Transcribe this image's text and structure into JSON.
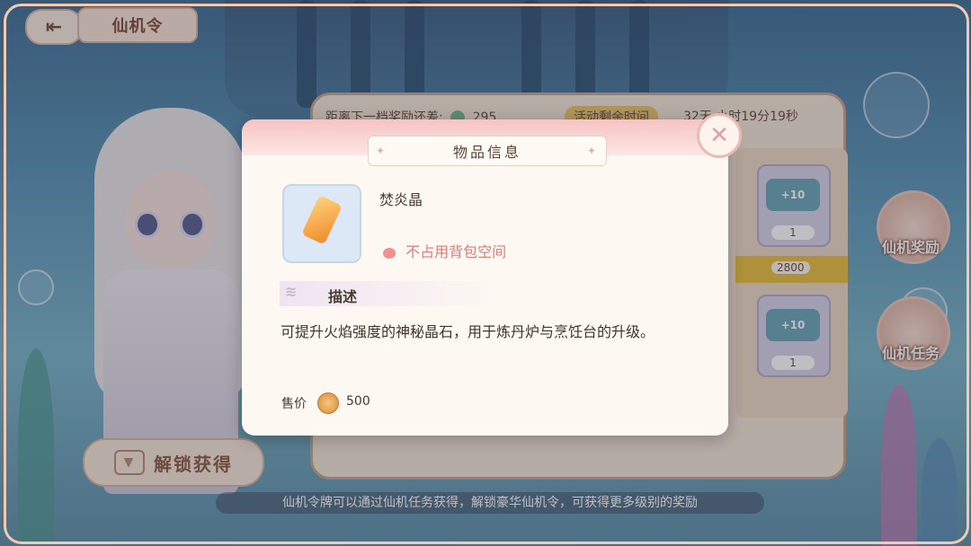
{
  "header": {
    "back_icon": "back-arrow-icon",
    "title": "仙机令"
  },
  "background": {
    "next_reward_label": "距离下一档奖励还差:",
    "next_reward_value": "295",
    "time_tag": "活动剩余时间",
    "time_value": "32天 小时19分19秒",
    "level_points": "2800",
    "reward_cards": [
      {
        "badge": "+10",
        "count": "1"
      },
      {
        "badge": "+10",
        "count": "1"
      }
    ],
    "unlock_button": "解锁获得",
    "side_buttons": [
      "仙机奖励",
      "仙机任务"
    ],
    "hint": "仙机令牌可以通过仙机任务获得，解锁豪华仙机令，可获得更多级别的奖励"
  },
  "modal": {
    "title": "物品信息",
    "close_icon": "close-icon",
    "item_name": "焚炎晶",
    "item_icon": "crystal-icon",
    "space_note": "不占用背包空间",
    "desc_heading": "描述",
    "description": "可提升火焰强度的神秘晶石，用于炼丹炉与烹饪台的升级。",
    "price_label": "售价",
    "price_value": "500"
  }
}
